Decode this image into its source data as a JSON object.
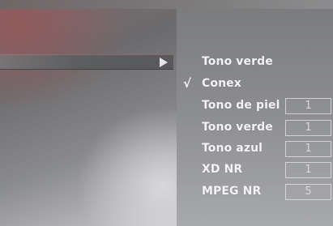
{
  "submenu": {
    "arrow_icon": "triangle-right-icon"
  },
  "menu": {
    "items": [
      {
        "label": "Tono verde",
        "checked": false,
        "has_value": false
      },
      {
        "label": "Conex",
        "checked": true,
        "check_mark": "√",
        "has_value": false
      },
      {
        "label": "Tono de piel",
        "checked": false,
        "has_value": true,
        "value": "1"
      },
      {
        "label": "Tono verde",
        "checked": false,
        "has_value": true,
        "value": "1"
      },
      {
        "label": "Tono azul",
        "checked": false,
        "has_value": true,
        "value": "1"
      },
      {
        "label": "XD NR",
        "checked": false,
        "has_value": true,
        "value": "1"
      },
      {
        "label": "MPEG NR",
        "checked": false,
        "has_value": true,
        "value": "5"
      }
    ]
  },
  "colors": {
    "text": "#f4f4f6",
    "value_text": "#d8d8da",
    "panel": "#8b8c8e",
    "highlight_bar": "#5d5e60"
  }
}
